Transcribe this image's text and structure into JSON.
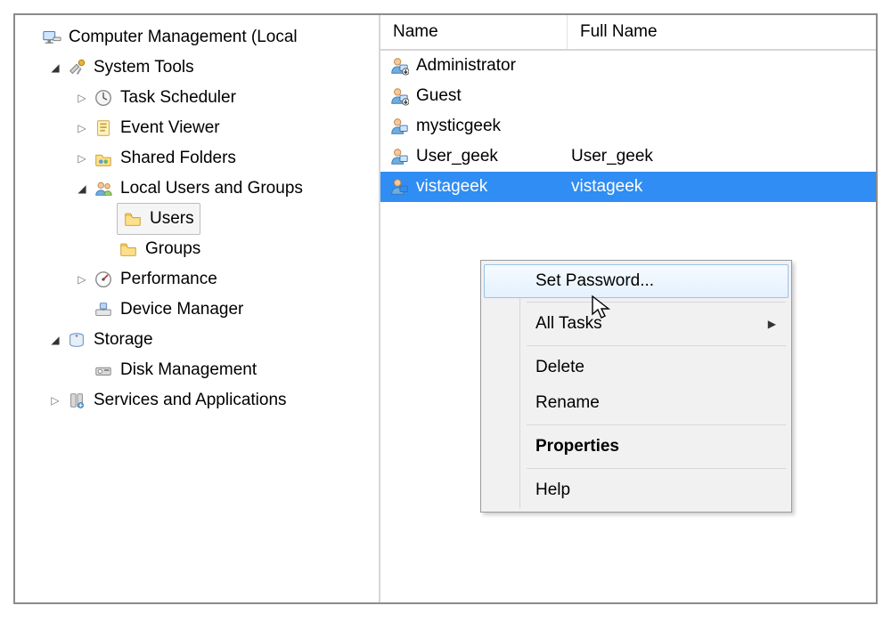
{
  "tree": {
    "root": "Computer Management (Local",
    "system_tools": "System Tools",
    "task_scheduler": "Task Scheduler",
    "event_viewer": "Event Viewer",
    "shared_folders": "Shared Folders",
    "local_users_groups": "Local Users and Groups",
    "users": "Users",
    "groups": "Groups",
    "performance": "Performance",
    "device_manager": "Device Manager",
    "storage": "Storage",
    "disk_management": "Disk Management",
    "services_apps": "Services and Applications"
  },
  "columns": {
    "name": "Name",
    "full_name": "Full Name"
  },
  "users": [
    {
      "name": "Administrator",
      "full": "",
      "down": true
    },
    {
      "name": "Guest",
      "full": "",
      "down": true
    },
    {
      "name": "mysticgeek",
      "full": "",
      "down": false
    },
    {
      "name": "User_geek",
      "full": "User_geek",
      "down": false
    },
    {
      "name": "vistageek",
      "full": "vistageek",
      "down": false,
      "selected": true
    }
  ],
  "menu": {
    "set_password": "Set Password...",
    "all_tasks": "All Tasks",
    "delete": "Delete",
    "rename": "Rename",
    "properties": "Properties",
    "help": "Help"
  }
}
